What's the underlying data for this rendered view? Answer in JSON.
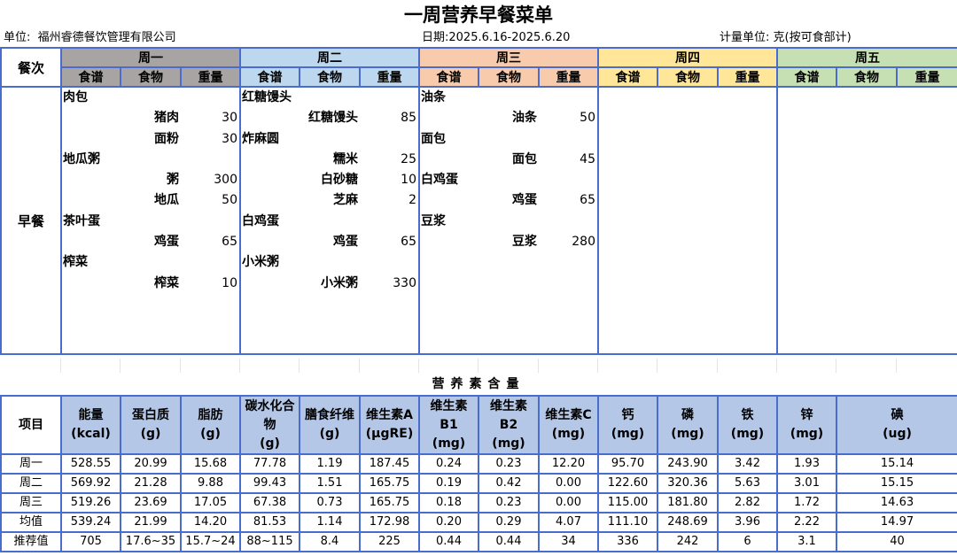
{
  "title": "一周营养早餐菜单",
  "info": {
    "unit_label": "单位:",
    "unit_value": "福州睿德餐饮管理有限公司",
    "date_label": "日期:",
    "date_value": "2025.6.16-2025.6.20",
    "measure_label": "计量单位:",
    "measure_value": "克(按可食部计)"
  },
  "menu": {
    "meal_col_header": "餐次",
    "meal_name": "早餐",
    "sub_headers": [
      "食谱",
      "食物",
      "重量"
    ],
    "days": [
      {
        "name": "周一",
        "rows": [
          {
            "dish": "肉包",
            "food": "",
            "qty": ""
          },
          {
            "dish": "",
            "food": "猪肉",
            "qty": "30"
          },
          {
            "dish": "",
            "food": "面粉",
            "qty": "30"
          },
          {
            "dish": "地瓜粥",
            "food": "",
            "qty": ""
          },
          {
            "dish": "",
            "food": "粥",
            "qty": "300"
          },
          {
            "dish": "",
            "food": "地瓜",
            "qty": "50"
          },
          {
            "dish": "茶叶蛋",
            "food": "",
            "qty": ""
          },
          {
            "dish": "",
            "food": "鸡蛋",
            "qty": "65"
          },
          {
            "dish": "榨菜",
            "food": "",
            "qty": ""
          },
          {
            "dish": "",
            "food": "榨菜",
            "qty": "10"
          }
        ]
      },
      {
        "name": "周二",
        "rows": [
          {
            "dish": "红糖馒头",
            "food": "",
            "qty": ""
          },
          {
            "dish": "",
            "food": "红糖馒头",
            "qty": "85"
          },
          {
            "dish": "炸麻圆",
            "food": "",
            "qty": ""
          },
          {
            "dish": "",
            "food": "糯米",
            "qty": "25"
          },
          {
            "dish": "",
            "food": "白砂糖",
            "qty": "10"
          },
          {
            "dish": "",
            "food": "芝麻",
            "qty": "2"
          },
          {
            "dish": "白鸡蛋",
            "food": "",
            "qty": ""
          },
          {
            "dish": "",
            "food": "鸡蛋",
            "qty": "65"
          },
          {
            "dish": "小米粥",
            "food": "",
            "qty": ""
          },
          {
            "dish": "",
            "food": "小米粥",
            "qty": "330"
          }
        ]
      },
      {
        "name": "周三",
        "rows": [
          {
            "dish": "油条",
            "food": "",
            "qty": ""
          },
          {
            "dish": "",
            "food": "油条",
            "qty": "50"
          },
          {
            "dish": "面包",
            "food": "",
            "qty": ""
          },
          {
            "dish": "",
            "food": "面包",
            "qty": "45"
          },
          {
            "dish": "白鸡蛋",
            "food": "",
            "qty": ""
          },
          {
            "dish": "",
            "food": "鸡蛋",
            "qty": "65"
          },
          {
            "dish": "豆浆",
            "food": "",
            "qty": ""
          },
          {
            "dish": "",
            "food": "豆浆",
            "qty": "280"
          }
        ]
      },
      {
        "name": "周四",
        "rows": []
      },
      {
        "name": "周五",
        "rows": []
      }
    ]
  },
  "nutrition": {
    "section_title": "营养素含量",
    "item_header": "项目",
    "headers": [
      [
        "能量",
        "(kcal)"
      ],
      [
        "蛋白质",
        "(g)"
      ],
      [
        "脂肪",
        "(g)"
      ],
      [
        "碳水化合",
        "物",
        "(g)"
      ],
      [
        "膳食纤维",
        "(g)"
      ],
      [
        "维生素A",
        "(μgRE)"
      ],
      [
        "维生素",
        "B1",
        "(mg)"
      ],
      [
        "维生素",
        "B2",
        "(mg)"
      ],
      [
        "维生素C",
        "(mg)"
      ],
      [
        "钙",
        "(mg)"
      ],
      [
        "磷",
        "(mg)"
      ],
      [
        "铁",
        "(mg)"
      ],
      [
        "锌",
        "(mg)"
      ],
      [
        "碘",
        "(ug)"
      ]
    ],
    "rows": [
      {
        "label": "周一",
        "values": [
          "528.55",
          "20.99",
          "15.68",
          "77.78",
          "1.19",
          "187.45",
          "0.24",
          "0.23",
          "12.20",
          "95.70",
          "243.90",
          "3.42",
          "1.93",
          "15.14"
        ]
      },
      {
        "label": "周二",
        "values": [
          "569.92",
          "21.28",
          "9.88",
          "99.43",
          "1.51",
          "165.75",
          "0.19",
          "0.42",
          "0.00",
          "122.60",
          "320.36",
          "5.63",
          "3.01",
          "15.15"
        ]
      },
      {
        "label": "周三",
        "values": [
          "519.26",
          "23.69",
          "17.05",
          "67.38",
          "0.73",
          "165.75",
          "0.18",
          "0.23",
          "0.00",
          "115.00",
          "181.80",
          "2.82",
          "1.72",
          "14.63"
        ]
      },
      {
        "label": "均值",
        "values": [
          "539.24",
          "21.99",
          "14.20",
          "81.53",
          "1.14",
          "172.98",
          "0.20",
          "0.29",
          "4.07",
          "111.10",
          "248.69",
          "3.96",
          "2.22",
          "14.97"
        ]
      },
      {
        "label": "推荐值",
        "values": [
          "705",
          "17.6~35",
          "15.7~24",
          "88~115",
          "8.4",
          "225",
          "0.44",
          "0.44",
          "34",
          "336",
          "242",
          "6",
          "3.1",
          "40"
        ]
      }
    ]
  }
}
